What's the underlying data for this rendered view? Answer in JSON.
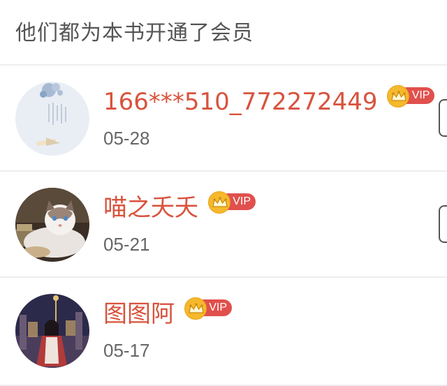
{
  "header": {
    "title": "他们都为本书开通了会员"
  },
  "members": [
    {
      "name": "166***510_772272449",
      "vip_label": "VIP",
      "date": "05-28",
      "avatar": "poem-scroll-avatar"
    },
    {
      "name": "喵之夭夭",
      "vip_label": "VIP",
      "date": "05-21",
      "avatar": "cat-avatar"
    },
    {
      "name": "图图阿",
      "vip_label": "VIP",
      "date": "05-17",
      "avatar": "game-character-avatar"
    }
  ],
  "colors": {
    "name": "#d8533d",
    "vip_pill": "#e0504d",
    "crown_badge": "#f6b82c",
    "date": "#666666",
    "divider": "#eeeeee"
  }
}
